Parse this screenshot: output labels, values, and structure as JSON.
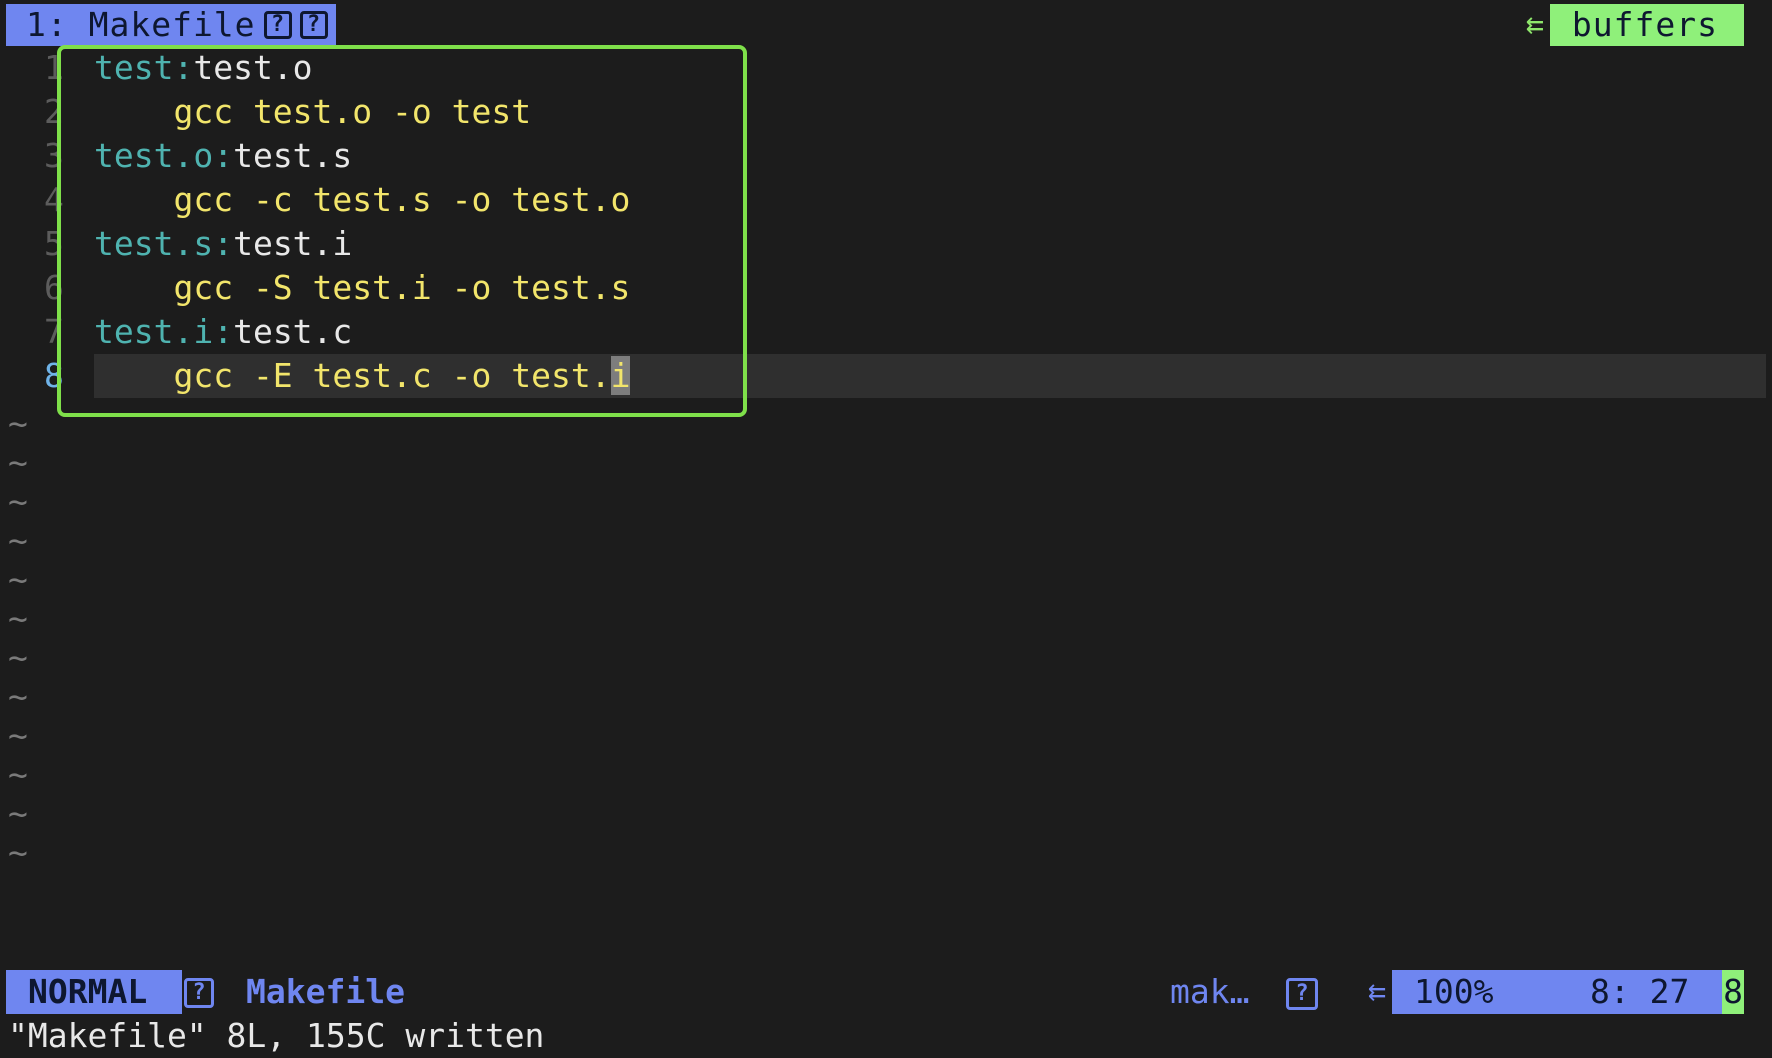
{
  "tabline": {
    "active_tab": "1: Makefile",
    "tab_icons": [
      "?",
      "?"
    ],
    "right_label": "buffers",
    "right_icon": "arrow-left-icon"
  },
  "editor": {
    "lines": [
      {
        "num": "1",
        "target": "test:",
        "dep": "test.o",
        "cmd": ""
      },
      {
        "num": "2",
        "target": "",
        "dep": "",
        "cmd": "    gcc test.o -o test"
      },
      {
        "num": "3",
        "target": "test.o:",
        "dep": "test.s",
        "cmd": ""
      },
      {
        "num": "4",
        "target": "",
        "dep": "",
        "cmd": "    gcc -c test.s -o test.o"
      },
      {
        "num": "5",
        "target": "test.s:",
        "dep": "test.i",
        "cmd": ""
      },
      {
        "num": "6",
        "target": "",
        "dep": "",
        "cmd": "    gcc -S test.i -o test.s"
      },
      {
        "num": "7",
        "target": "test.i:",
        "dep": "test.c",
        "cmd": ""
      },
      {
        "num": "8",
        "target": "",
        "dep": "",
        "cmd": "    gcc -E test.c -o test.",
        "cursor_char": "i"
      }
    ],
    "tilde": "~",
    "tilde_count": 12
  },
  "statusline": {
    "mode": "NORMAL",
    "status_icon": "?",
    "filename": "Makefile",
    "filetype": "mak…",
    "filetype_icon": "?",
    "arrow_icon": "arrow-left-icon",
    "percent": "100%",
    "position": "8: 27",
    "line_count": "8"
  },
  "cmdline": {
    "message": "\"Makefile\" 8L, 155C written"
  },
  "colors": {
    "background": "#1c1c1c",
    "accent_blue": "#6f86f0",
    "accent_green": "#8ff07a",
    "highlight_box": "#7fe04a",
    "target_teal": "#4fb3b0",
    "command_yellow": "#f2e56b"
  }
}
